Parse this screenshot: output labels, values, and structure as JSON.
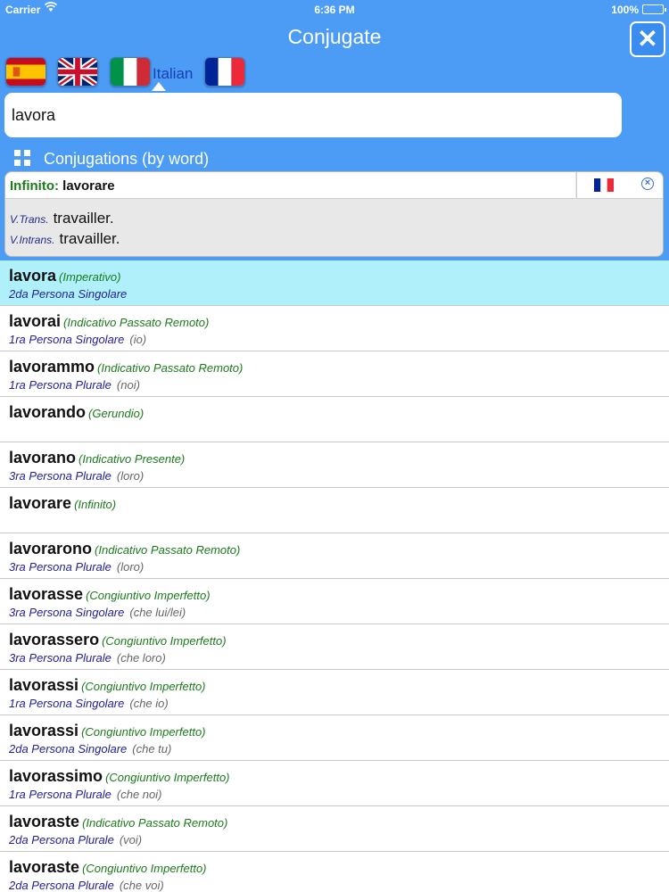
{
  "status_bar": {
    "carrier": "Carrier",
    "time": "6:36 PM",
    "battery": "100%"
  },
  "header": {
    "title": "Conjugate",
    "close_symbol": "✕"
  },
  "languages": {
    "selected_label": "Italian",
    "flags": [
      "spanish-flag-icon",
      "uk-flag-icon",
      "italian-flag-icon",
      "french-flag-icon"
    ]
  },
  "search": {
    "value": "lavora"
  },
  "section": {
    "title": "Conjugations (by word)"
  },
  "infinitive": {
    "label": "Infinito:",
    "value": "lavorare",
    "translations": [
      {
        "pos": "V.Trans.",
        "text": "travailler."
      },
      {
        "pos": "V.Intrans.",
        "text": "travailler."
      }
    ]
  },
  "conjugations": [
    {
      "word": "lavora",
      "tense": "(Imperativo)",
      "person": "2da Persona Singolare",
      "pronoun": ""
    },
    {
      "word": "lavorai",
      "tense": "(Indicativo Passato Remoto)",
      "person": "1ra Persona Singolare",
      "pronoun": "(io)"
    },
    {
      "word": "lavorammo",
      "tense": "(Indicativo Passato Remoto)",
      "person": "1ra Persona Plurale",
      "pronoun": "(noi)"
    },
    {
      "word": "lavorando",
      "tense": "(Gerundio)",
      "person": "",
      "pronoun": ""
    },
    {
      "word": "lavorano",
      "tense": "(Indicativo Presente)",
      "person": "3ra Persona Plurale",
      "pronoun": "(loro)"
    },
    {
      "word": "lavorare",
      "tense": "(Infinito)",
      "person": "",
      "pronoun": ""
    },
    {
      "word": "lavorarono",
      "tense": "(Indicativo Passato Remoto)",
      "person": "3ra Persona Plurale",
      "pronoun": "(loro)"
    },
    {
      "word": "lavorasse",
      "tense": "(Congiuntivo Imperfetto)",
      "person": "3ra Persona Singolare",
      "pronoun": "(che lui/lei)"
    },
    {
      "word": "lavorassero",
      "tense": "(Congiuntivo Imperfetto)",
      "person": "3ra Persona Plurale",
      "pronoun": "(che loro)"
    },
    {
      "word": "lavorassi",
      "tense": "(Congiuntivo Imperfetto)",
      "person": "1ra Persona Singolare",
      "pronoun": "(che io)"
    },
    {
      "word": "lavorassi",
      "tense": "(Congiuntivo Imperfetto)",
      "person": "2da Persona Singolare",
      "pronoun": "(che tu)"
    },
    {
      "word": "lavorassimo",
      "tense": "(Congiuntivo Imperfetto)",
      "person": "1ra Persona Plurale",
      "pronoun": "(che noi)"
    },
    {
      "word": "lavoraste",
      "tense": "(Indicativo Passato Remoto)",
      "person": "2da Persona Plurale",
      "pronoun": "(voi)"
    },
    {
      "word": "lavoraste",
      "tense": "(Congiuntivo Imperfetto)",
      "person": "2da Persona Plurale",
      "pronoun": "(che voi)"
    }
  ],
  "colors": {
    "accent": "#4c9cf5",
    "selected_row": "#b0f0fb",
    "tense": "#1b7a1b",
    "person": "#22209a"
  }
}
